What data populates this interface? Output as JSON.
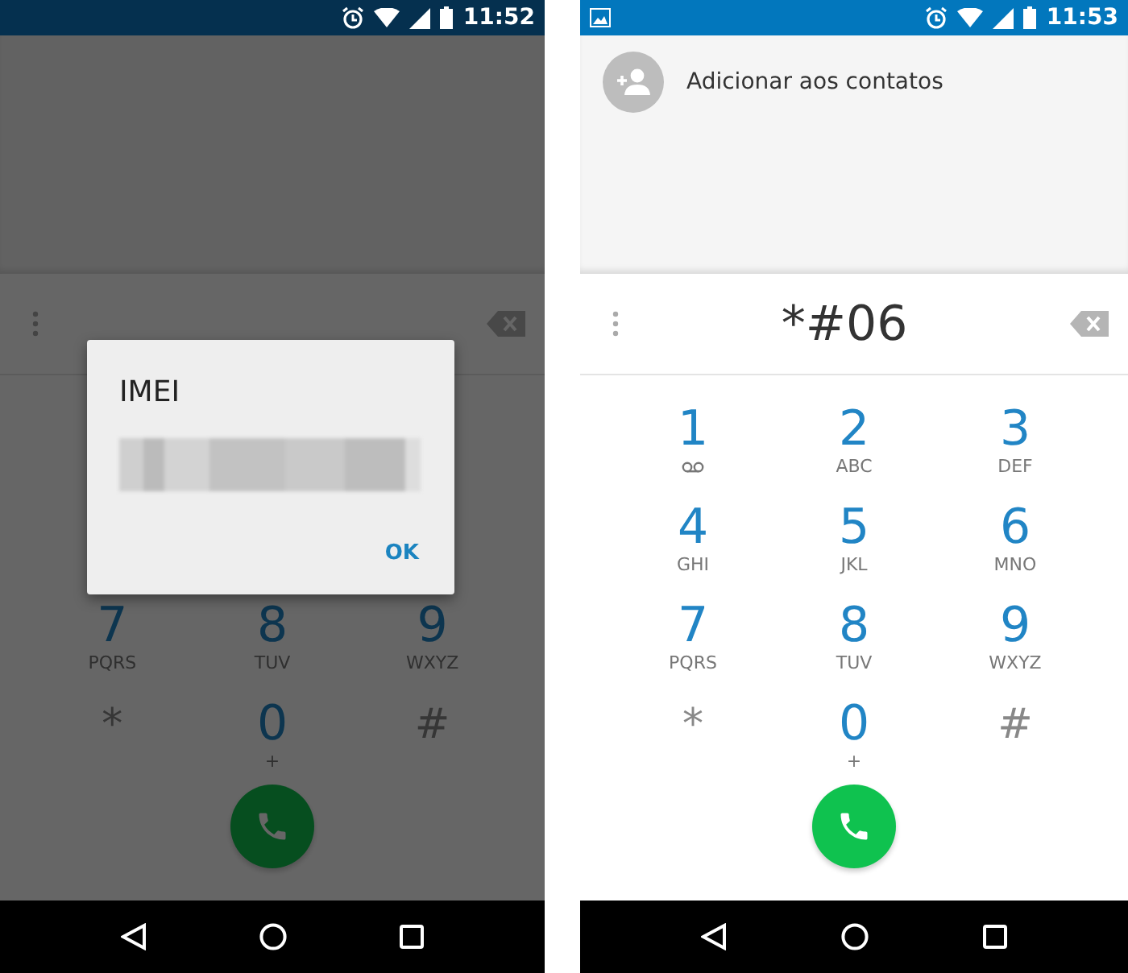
{
  "phones": [
    {
      "dimmed": true,
      "status_bar": {
        "time": "11:52",
        "notification_icon": false
      },
      "keys": [
        {
          "digit": "7",
          "kind": "letters",
          "letters": "PQRS"
        },
        {
          "digit": "8",
          "kind": "letters",
          "letters": "TUV"
        },
        {
          "digit": "9",
          "kind": "letters",
          "letters": "WXYZ"
        },
        {
          "digit": "*",
          "kind": "symbol"
        },
        {
          "digit": "0",
          "kind": "letters",
          "letters": "+"
        },
        {
          "digit": "#",
          "kind": "symbol"
        }
      ],
      "dialog": {
        "title": "IMEI",
        "button": "OK"
      }
    },
    {
      "dimmed": false,
      "status_bar": {
        "time": "11:53",
        "notification_icon": true
      },
      "add_contact": "Adicionar aos contatos",
      "number": "*#06",
      "keys": [
        {
          "digit": "1",
          "kind": "voicemail"
        },
        {
          "digit": "2",
          "kind": "letters",
          "letters": "ABC"
        },
        {
          "digit": "3",
          "kind": "letters",
          "letters": "DEF"
        },
        {
          "digit": "4",
          "kind": "letters",
          "letters": "GHI"
        },
        {
          "digit": "5",
          "kind": "letters",
          "letters": "JKL"
        },
        {
          "digit": "6",
          "kind": "letters",
          "letters": "MNO"
        },
        {
          "digit": "7",
          "kind": "letters",
          "letters": "PQRS"
        },
        {
          "digit": "8",
          "kind": "letters",
          "letters": "TUV"
        },
        {
          "digit": "9",
          "kind": "letters",
          "letters": "WXYZ"
        },
        {
          "digit": "*",
          "kind": "symbol"
        },
        {
          "digit": "0",
          "kind": "letters",
          "letters": "+"
        },
        {
          "digit": "#",
          "kind": "symbol"
        }
      ]
    }
  ]
}
